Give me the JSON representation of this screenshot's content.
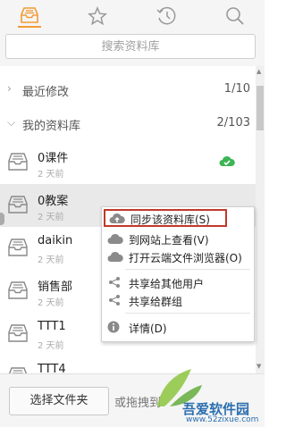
{
  "toolbar": {
    "icons": [
      "library-icon",
      "star-icon",
      "history-icon",
      "search-icon"
    ]
  },
  "search": {
    "placeholder": "搜索资料库"
  },
  "sections": {
    "recent": {
      "label": "最近修改",
      "count": "1/10"
    },
    "mine": {
      "label": "我的资料库",
      "count": "2/103"
    }
  },
  "libraries": [
    {
      "name": "0课件",
      "subtitle": "2 天前",
      "synced": true
    },
    {
      "name": "0教案",
      "subtitle": "2 天前"
    },
    {
      "name": "daikin",
      "subtitle": "2 天前"
    },
    {
      "name": "销售部",
      "subtitle": "2 天前"
    },
    {
      "name": "TTT1",
      "subtitle": "2 天前"
    },
    {
      "name": "TTT4",
      "subtitle": ""
    }
  ],
  "context_menu": {
    "items": [
      {
        "label": "同步该资料库(S)",
        "icon": "cloud-sync-icon",
        "highlighted": true
      },
      {
        "label": "到网站上查看(V)",
        "icon": "cloud-icon"
      },
      {
        "label": "打开云端文件浏览器(O)",
        "icon": "cloud-icon"
      },
      {
        "label": "共享给其他用户",
        "icon": "share-icon"
      },
      {
        "label": "共享给群组",
        "icon": "share-icon"
      },
      {
        "label": "详情(D)",
        "icon": "info-icon"
      }
    ]
  },
  "bottom": {
    "choose_folder": "选择文件夹",
    "drop_hint": "或拖拽到"
  },
  "watermark": {
    "site_name": "吾爱软件园",
    "url": "www.52zixue.com"
  },
  "colors": {
    "accent": "#f29b38",
    "sync_green": "#3cb554",
    "highlight_border": "#c0392b"
  }
}
